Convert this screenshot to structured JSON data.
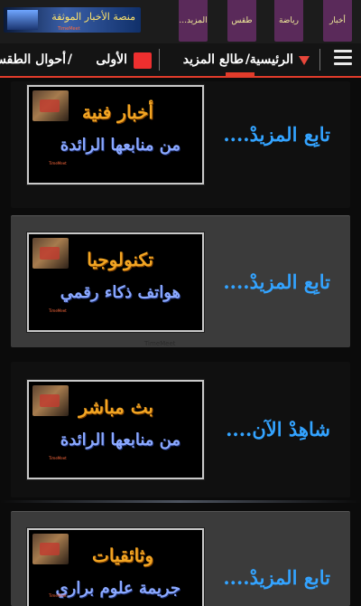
{
  "header": {
    "logo_text": "منصة الأخبار الموثقة",
    "logo_sub": "TimeMeet",
    "tabs": [
      {
        "label": "أخبار"
      },
      {
        "label": "رياضة"
      },
      {
        "label": "طقس"
      },
      {
        "label": "المزيد..."
      }
    ]
  },
  "breadcrumb": {
    "home": "الرئيسية",
    "more": "طالع المزيد",
    "first": "الأولى",
    "weather": "أحوال الطقس",
    "separator": "/"
  },
  "feed": [
    {
      "title": "أخبار فنية",
      "subtitle": "من منابعها الرائدة",
      "link": "تابِع المزيدْ....",
      "stamp": "TimeMeet"
    },
    {
      "title": "تكنولوجيا",
      "subtitle": "هواتف ذكاء رقمي",
      "link": "تابِع المزيدْ....",
      "stamp": "TimeMeet"
    },
    {
      "title": "بث مباشر",
      "subtitle": "من منابعها الرائدة",
      "link": "شاهِدْ الآن....",
      "stamp": "TimeMeet"
    },
    {
      "title": "وثائقيات",
      "subtitle": "جريمة علوم براري",
      "link": "تابع المزيدْ....",
      "stamp": "TimeMeet"
    }
  ],
  "watermark": "TimeMeet",
  "colors": {
    "accent_red": "#e23c2b",
    "link_blue": "#33a3ff",
    "tab_purple": "#5a2a5a",
    "title_orange": "#f2a523"
  }
}
